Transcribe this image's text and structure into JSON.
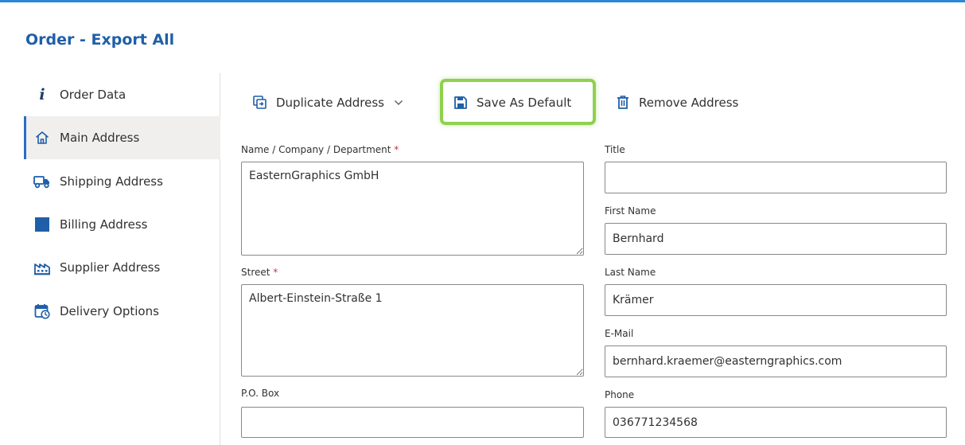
{
  "dialog": {
    "title": "Order - Export All"
  },
  "sidebar": {
    "items": [
      {
        "label": "Order Data",
        "icon": "info-icon",
        "active": false
      },
      {
        "label": "Main Address",
        "icon": "home-icon",
        "active": true
      },
      {
        "label": "Shipping Address",
        "icon": "truck-icon",
        "active": false
      },
      {
        "label": "Billing Address",
        "icon": "billing-icon",
        "active": false
      },
      {
        "label": "Supplier Address",
        "icon": "factory-icon",
        "active": false
      },
      {
        "label": "Delivery Options",
        "icon": "calendar-clock-icon",
        "active": false
      }
    ]
  },
  "toolbar": {
    "duplicate_label": "Duplicate Address",
    "save_default_label": "Save As Default",
    "remove_label": "Remove Address"
  },
  "form": {
    "name_company": {
      "label": "Name / Company / Department",
      "required_mark": "*",
      "value": "EasternGraphics GmbH"
    },
    "street": {
      "label": "Street",
      "required_mark": "*",
      "value": "Albert-Einstein-Straße 1"
    },
    "po_box": {
      "label": "P.O. Box",
      "value": ""
    },
    "title": {
      "label": "Title",
      "value": ""
    },
    "first_name": {
      "label": "First Name",
      "value": "Bernhard"
    },
    "last_name": {
      "label": "Last Name",
      "value": "Krämer"
    },
    "email": {
      "label": "E-Mail",
      "value": "bernhard.kraemer@easterngraphics.com"
    },
    "phone": {
      "label": "Phone",
      "value": "036771234568"
    }
  },
  "colors": {
    "accent": "#1f5fa8",
    "active_bar": "#2b6cc2",
    "highlight": "#8fd14f",
    "required": "#c4314b"
  }
}
